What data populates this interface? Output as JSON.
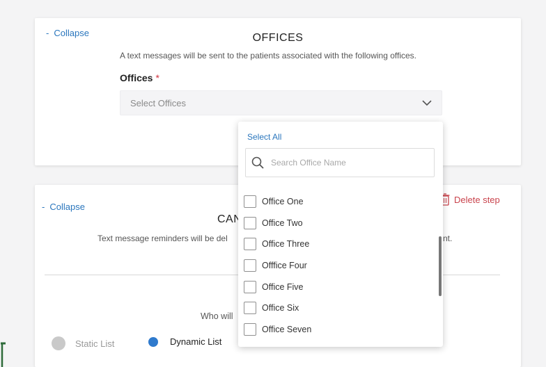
{
  "offices_card": {
    "collapse_label": "Collapse",
    "title": "OFFICES",
    "description": "A text messages will be sent to the patients associated with the following offices.",
    "field_label": "Offices",
    "required_mark": "*",
    "select_placeholder": "Select Offices"
  },
  "second_card": {
    "collapse_label": "Collapse",
    "title_partial": "CAN",
    "description_partial": "Text message reminders will be del",
    "description_tail": "nt.",
    "subheading_partial": "Who will",
    "delete_label": "Delete step",
    "radio_options": [
      {
        "label": "Static List",
        "selected": false
      },
      {
        "label": "Dynamic List",
        "selected": true
      }
    ]
  },
  "dropdown": {
    "select_all_label": "Select All",
    "search_placeholder": "Search Office Name",
    "options": [
      {
        "label": "Office One",
        "checked": false
      },
      {
        "label": "Office Two",
        "checked": false
      },
      {
        "label": "Office Three",
        "checked": false
      },
      {
        "label": "Offfice Four",
        "checked": false
      },
      {
        "label": "Office Five",
        "checked": false
      },
      {
        "label": "Office Six",
        "checked": false
      },
      {
        "label": "Office Seven",
        "checked": false
      }
    ]
  },
  "colors": {
    "link": "#2a76bd",
    "danger": "#c9434c",
    "radio_selected": "#2f7acd",
    "radio_unselected": "#c9c9c9",
    "green_edge": "#2e6b3a"
  },
  "icons": {
    "collapse": "minus-icon",
    "select": "chevron-down-icon",
    "search": "search-icon",
    "delete": "trash-icon"
  }
}
